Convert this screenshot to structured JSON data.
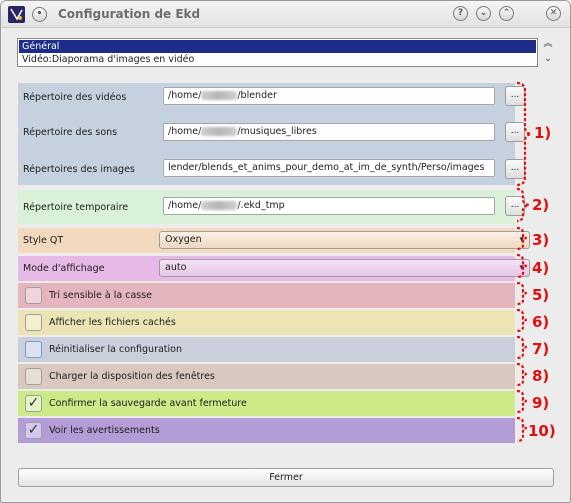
{
  "window": {
    "title": "Configuration de Ekd",
    "close_glyph": "✕",
    "help_glyph": "?",
    "min_glyph": "⌄",
    "max_glyph": "⌃",
    "menu_glyph": "•"
  },
  "categories": {
    "items": [
      "Général",
      "Vidéo:Diaporama d'images en vidéo"
    ],
    "selected": "Général",
    "scroll_up": "︽",
    "scroll_down": "⌄"
  },
  "settings": {
    "videos": {
      "label": "Répertoire des vidéos",
      "value_prefix": "/home/",
      "value_suffix": "/blender",
      "button": "..."
    },
    "sons": {
      "label": "Répertoire des sons",
      "value_prefix": "/home/",
      "value_suffix": "/musiques_libres",
      "button": "..."
    },
    "images": {
      "label": "Répertoires des images",
      "value": "lender/blends_et_anims_pour_demo_at_im_de_synth/Perso/images",
      "button": "..."
    },
    "temp": {
      "label": "Répertoire temporaire",
      "value_prefix": "/home/",
      "value_suffix": "/.ekd_tmp",
      "button": "..."
    },
    "style_qt": {
      "label": "Style QT",
      "value": "Oxygen"
    },
    "affichage": {
      "label": "Mode d'affichage",
      "value": "auto"
    },
    "tri": {
      "label": "Tri sensible à la casse",
      "checked": false
    },
    "caches": {
      "label": "Afficher les fichiers cachés",
      "checked": false
    },
    "reinit": {
      "label": "Réinitialiser la configuration",
      "checked": false
    },
    "disposition": {
      "label": "Charger la disposition des fenêtres",
      "checked": false
    },
    "confirmer": {
      "label": "Confirmer la sauvegarde avant fermeture",
      "checked": true,
      "mark": "✓"
    },
    "avertissements": {
      "label": "Voir les avertissements",
      "checked": true,
      "mark": "✓"
    }
  },
  "annotations": [
    "1)",
    "2)",
    "3)",
    "4)",
    "5)",
    "6)",
    "7)",
    "8)",
    "9)",
    "10)"
  ],
  "footer": {
    "close_label": "Fermer"
  },
  "colors": {
    "group1": "#c5d1df",
    "group2": "#d9f1d9",
    "group3": "#f2d8bd",
    "group4": "#e7b9e6",
    "group5": "#e5b5be",
    "group6": "#ede4b6",
    "group7": "#c9d0dc",
    "group8": "#d9c8bf",
    "group9": "#ccea87",
    "group10": "#b49cd6",
    "annotation": "#e01010",
    "selection": "#1e2d8a"
  }
}
